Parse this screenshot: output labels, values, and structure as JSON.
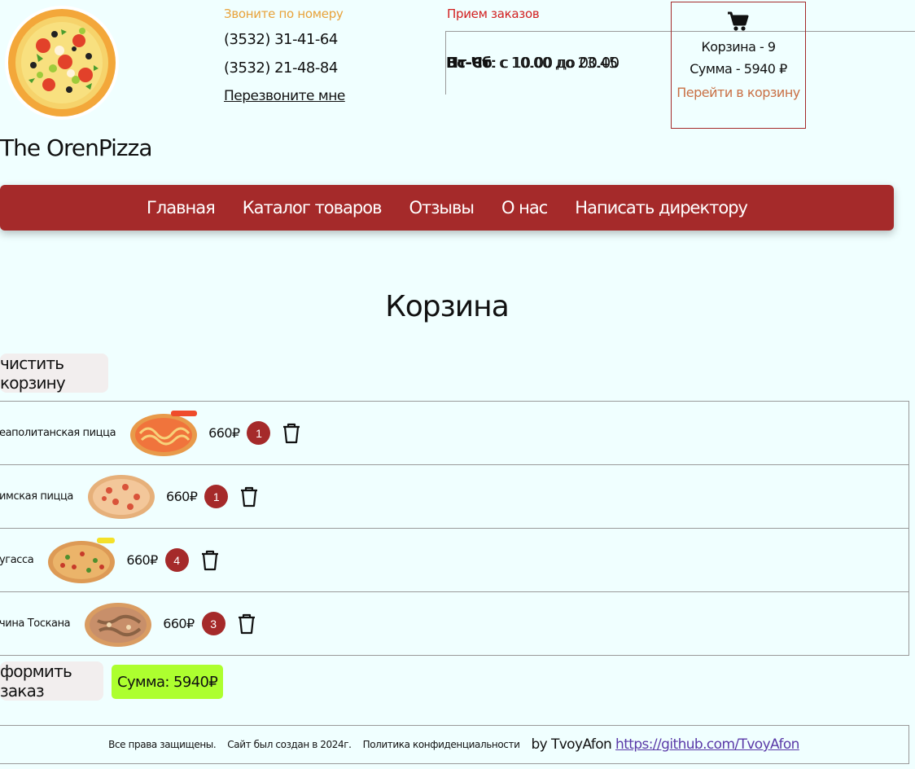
{
  "header": {
    "brand": "The OrenPizza",
    "contact_heading": "Звоните по номеру",
    "phone1": "(3532) 31-41-64",
    "phone2": "(3532) 21-48-84",
    "callback_link": "Перезвоните мне",
    "hours_heading": "Прием заказов",
    "hours": [
      {
        "days": "Вс-Чт",
        "time": ": с 10.00 до 23.45"
      },
      {
        "days": "Пт-Сб",
        "time": ": с 10.00 до 00.00"
      }
    ],
    "cart": {
      "count_text": "Корзина - 9",
      "sum_text": "Сумма - 5940 ₽",
      "go_link": "Перейти в корзину"
    }
  },
  "nav": {
    "items": [
      "Главная",
      "Каталог товаров",
      "Отзывы",
      "О нас",
      "Написать директору"
    ]
  },
  "main": {
    "title": "Корзина",
    "clear_button": "чистить корзину",
    "items": [
      {
        "name": "еаполитанская пицца",
        "price": "660₽",
        "qty": "1"
      },
      {
        "name": "имская пицца",
        "price": "660₽",
        "qty": "1"
      },
      {
        "name": "угасса",
        "price": "660₽",
        "qty": "4"
      },
      {
        "name": "чина Тоскана",
        "price": "660₽",
        "qty": "3"
      }
    ],
    "order_button": "формить заказ",
    "sum_badge": "Сумма: 5940₽"
  },
  "footer": {
    "rights": "Все права защищены.",
    "created": "Сайт был создан в 2024г.",
    "privacy": "Политика конфиденциальности",
    "by": "by TvoyAfon",
    "github": "https://github.com/TvoyAfon"
  },
  "colors": {
    "background": "#f0ffff",
    "accent": "#a52a2a",
    "sum_badge": "#adff2f"
  }
}
